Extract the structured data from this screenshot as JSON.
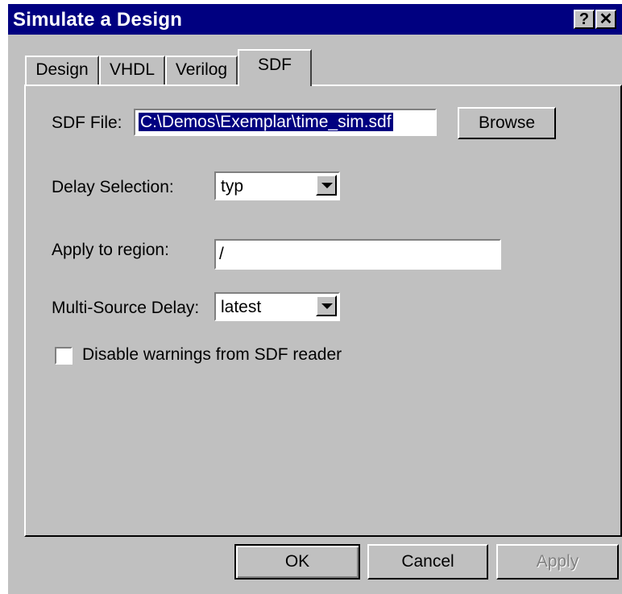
{
  "window": {
    "title": "Simulate a Design",
    "help_glyph": "?",
    "close_glyph": "✕"
  },
  "tabs": [
    {
      "label": "Design",
      "active": false
    },
    {
      "label": "VHDL",
      "active": false
    },
    {
      "label": "Verilog",
      "active": false
    },
    {
      "label": "SDF",
      "active": true
    }
  ],
  "sdf": {
    "file_label": "SDF File:",
    "file_value": "C:\\Demos\\Exemplar\\time_sim.sdf",
    "browse_label": "Browse",
    "delay_label": "Delay Selection:",
    "delay_value": "typ",
    "region_label": "Apply to region:",
    "region_value": "/",
    "multisource_label": "Multi-Source Delay:",
    "multisource_value": "latest",
    "disable_warnings_label": "Disable warnings from SDF reader",
    "disable_warnings_checked": false
  },
  "footer": {
    "ok_label": "OK",
    "cancel_label": "Cancel",
    "apply_label": "Apply"
  },
  "colors": {
    "titlebar": "#000080",
    "face": "#c0c0c0",
    "selection": "#000080"
  }
}
